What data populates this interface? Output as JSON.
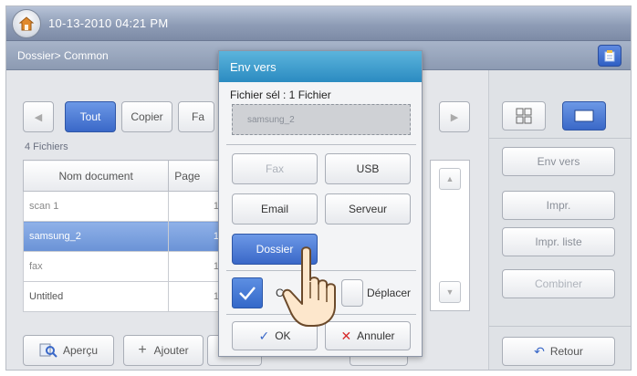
{
  "status": {
    "datetime": "10-13-2010 04:21 PM"
  },
  "path": {
    "text": "Dossier> Common"
  },
  "tabs": [
    {
      "label": "Tout",
      "active": true
    },
    {
      "label": "Copier",
      "active": false
    },
    {
      "label": "Fa"
    }
  ],
  "file_count": "4 Fichiers",
  "table": {
    "headers": [
      "Nom document",
      "Page"
    ],
    "rows": [
      {
        "name": "scan 1",
        "pages": "1",
        "selected": false
      },
      {
        "name": "samsung_2",
        "pages": "1",
        "selected": true
      },
      {
        "name": "fax",
        "pages": "1",
        "selected": false
      },
      {
        "name": "Untitled",
        "pages": "1",
        "selected": false
      }
    ]
  },
  "bottom": {
    "preview": "Aperçu",
    "add": "Ajouter"
  },
  "right": {
    "send": "Env vers",
    "print": "Impr.",
    "print_list": "Impr. liste",
    "combine": "Combiner",
    "back": "Retour"
  },
  "dialog": {
    "title": "Env vers",
    "selected_label": "Fichier sél : 1 Fichier",
    "selected_file": "samsung_2",
    "fax": "Fax",
    "usb": "USB",
    "email": "Email",
    "server": "Serveur",
    "folder": "Dossier",
    "copy": "C",
    "move": "Déplacer",
    "ok": "OK",
    "cancel": "Annuler"
  },
  "colors": {
    "accent_blue": "#3a68c8",
    "title_blue": "#2b8bc1",
    "cancel_red": "#d62a2a"
  }
}
